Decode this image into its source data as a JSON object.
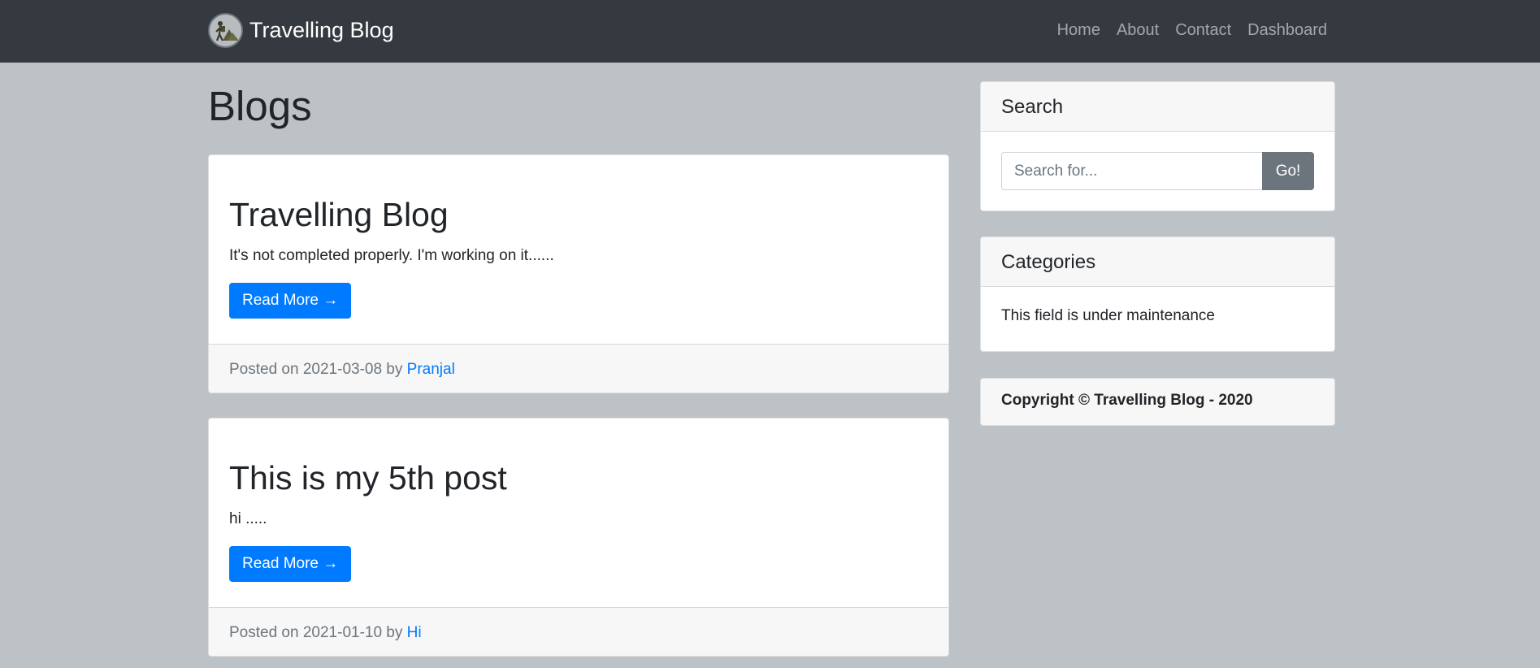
{
  "navbar": {
    "brand": "Travelling Blog",
    "links": [
      "Home",
      "About",
      "Contact",
      "Dashboard"
    ]
  },
  "main": {
    "title": "Blogs",
    "posts": [
      {
        "title": "Travelling Blog",
        "excerpt": "It's not completed properly. I'm working on it......",
        "read_more": "Read More →",
        "posted_prefix": "Posted on 2021-03-08 by",
        "author": "Pranjal"
      },
      {
        "title": "This is my 5th post",
        "excerpt": "hi .....",
        "read_more": "Read More →",
        "posted_prefix": "Posted on 2021-01-10 by",
        "author": "Hi"
      }
    ]
  },
  "sidebar": {
    "search": {
      "title": "Search",
      "placeholder": "Search for...",
      "button": "Go!"
    },
    "categories": {
      "title": "Categories",
      "text": "This field is under maintenance"
    },
    "copyright": "Copyright © Travelling Blog - 2020"
  }
}
